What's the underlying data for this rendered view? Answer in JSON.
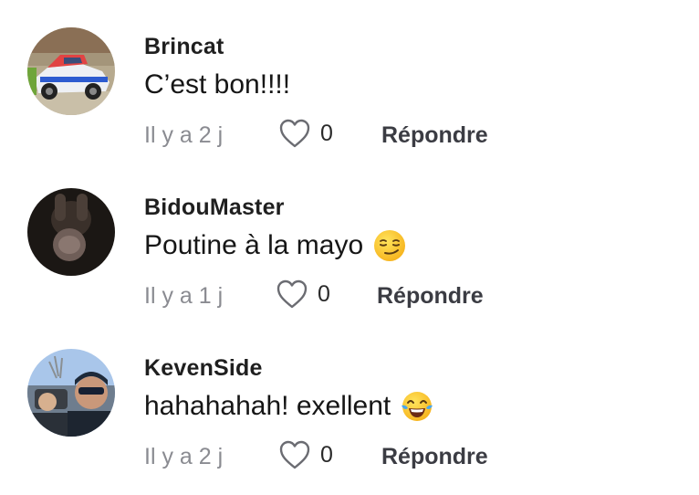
{
  "comments": [
    {
      "username": "Brincat",
      "text": "C’est bon!!!!",
      "emoji": "",
      "time": "Il y a 2 j",
      "likes": "0",
      "reply_label": "Répondre",
      "avatar": "race-car-photo"
    },
    {
      "username": "BidouMaster",
      "text": "Poutine à la mayo",
      "emoji": "smirking-face",
      "time": "Il y a 1 j",
      "likes": "0",
      "reply_label": "Répondre",
      "avatar": "dark-figure-photo"
    },
    {
      "username": "KevenSide",
      "text": "hahahahah! exellent",
      "emoji": "face-with-tears-of-joy",
      "time": "Il y a 2 j",
      "likes": "0",
      "reply_label": "Répondre",
      "avatar": "man-in-vehicle-photo"
    }
  ],
  "colors": {
    "username": "#1f1f1f",
    "meta": "#8a8b91",
    "reply": "#3b3c43",
    "background": "#ffffff"
  }
}
